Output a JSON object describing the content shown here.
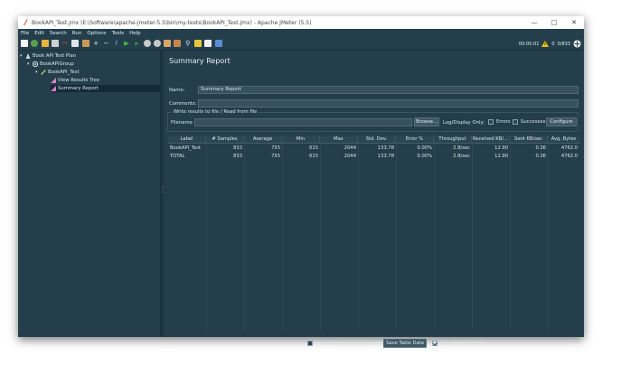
{
  "window": {
    "title": "BookAPI_Test.jmx (E:\\Software\\apache-jmeter-5.5\\bin\\my-tests\\BookAPI_Test.jmx) - Apache JMeter (5.5)"
  },
  "menu": [
    "File",
    "Edit",
    "Search",
    "Run",
    "Options",
    "Tools",
    "Help"
  ],
  "toolbar": {
    "elapsed": "00:05:01",
    "warning_count": "0",
    "threads": "0/833",
    "icons": [
      "new-icon",
      "templates-icon",
      "open-icon",
      "save-icon",
      "cut-icon",
      "copy-icon",
      "paste-icon",
      "expand-icon",
      "collapse-icon",
      "toggle-icon",
      "start-icon",
      "start-no-pause-icon",
      "stop-icon",
      "shutdown-icon",
      "clear-icon",
      "clear-all-icon",
      "search-icon",
      "reset-search-icon",
      "function-helper-icon",
      "help-icon"
    ]
  },
  "tree": [
    {
      "label": "Book APi Test Plan",
      "icon": "test-plan-icon"
    },
    {
      "label": "BookAPIGroup",
      "icon": "thread-group-icon"
    },
    {
      "label": "BookAPI_Test",
      "icon": "http-sampler-icon"
    },
    {
      "label": "View Results Tree",
      "icon": "listener-icon"
    },
    {
      "label": "Summary Report",
      "icon": "listener-icon"
    }
  ],
  "report": {
    "title": "Summary Report",
    "name_label": "Name:",
    "name_value": "Summary Report",
    "comments_label": "Comments:",
    "comments_value": "",
    "file_group_title": "Write results to file / Read from file",
    "filename_label": "Filename",
    "filename_value": "",
    "browse_label": "Browse...",
    "log_display_label": "Log/Display Only:",
    "errors_label": "Errors",
    "successes_label": "Successes",
    "configure_label": "Configure",
    "columns": [
      "Label",
      "# Samples",
      "Average",
      "Min",
      "Max",
      "Std. Dev.",
      "Error %",
      "Throughput",
      "Received KB/...",
      "Sent KB/sec",
      "Avg. Bytes"
    ],
    "rows": [
      [
        "BookAPI_Test",
        "833",
        "755",
        "615",
        "2044",
        "133.78",
        "0.00%",
        "2.8/sec",
        "12.90",
        "0.36",
        "4762.0"
      ],
      [
        "TOTAL",
        "833",
        "755",
        "615",
        "2044",
        "133.78",
        "0.00%",
        "2.8/sec",
        "12.90",
        "0.36",
        "4762.0"
      ]
    ],
    "include_group_label": "Include group name in label?",
    "save_table_data_label": "Save Table Data",
    "save_table_header_label": "Save Table Header"
  },
  "colors": {
    "background": "#243e4b",
    "selection": "#14293a",
    "warning": "#f2c200"
  }
}
